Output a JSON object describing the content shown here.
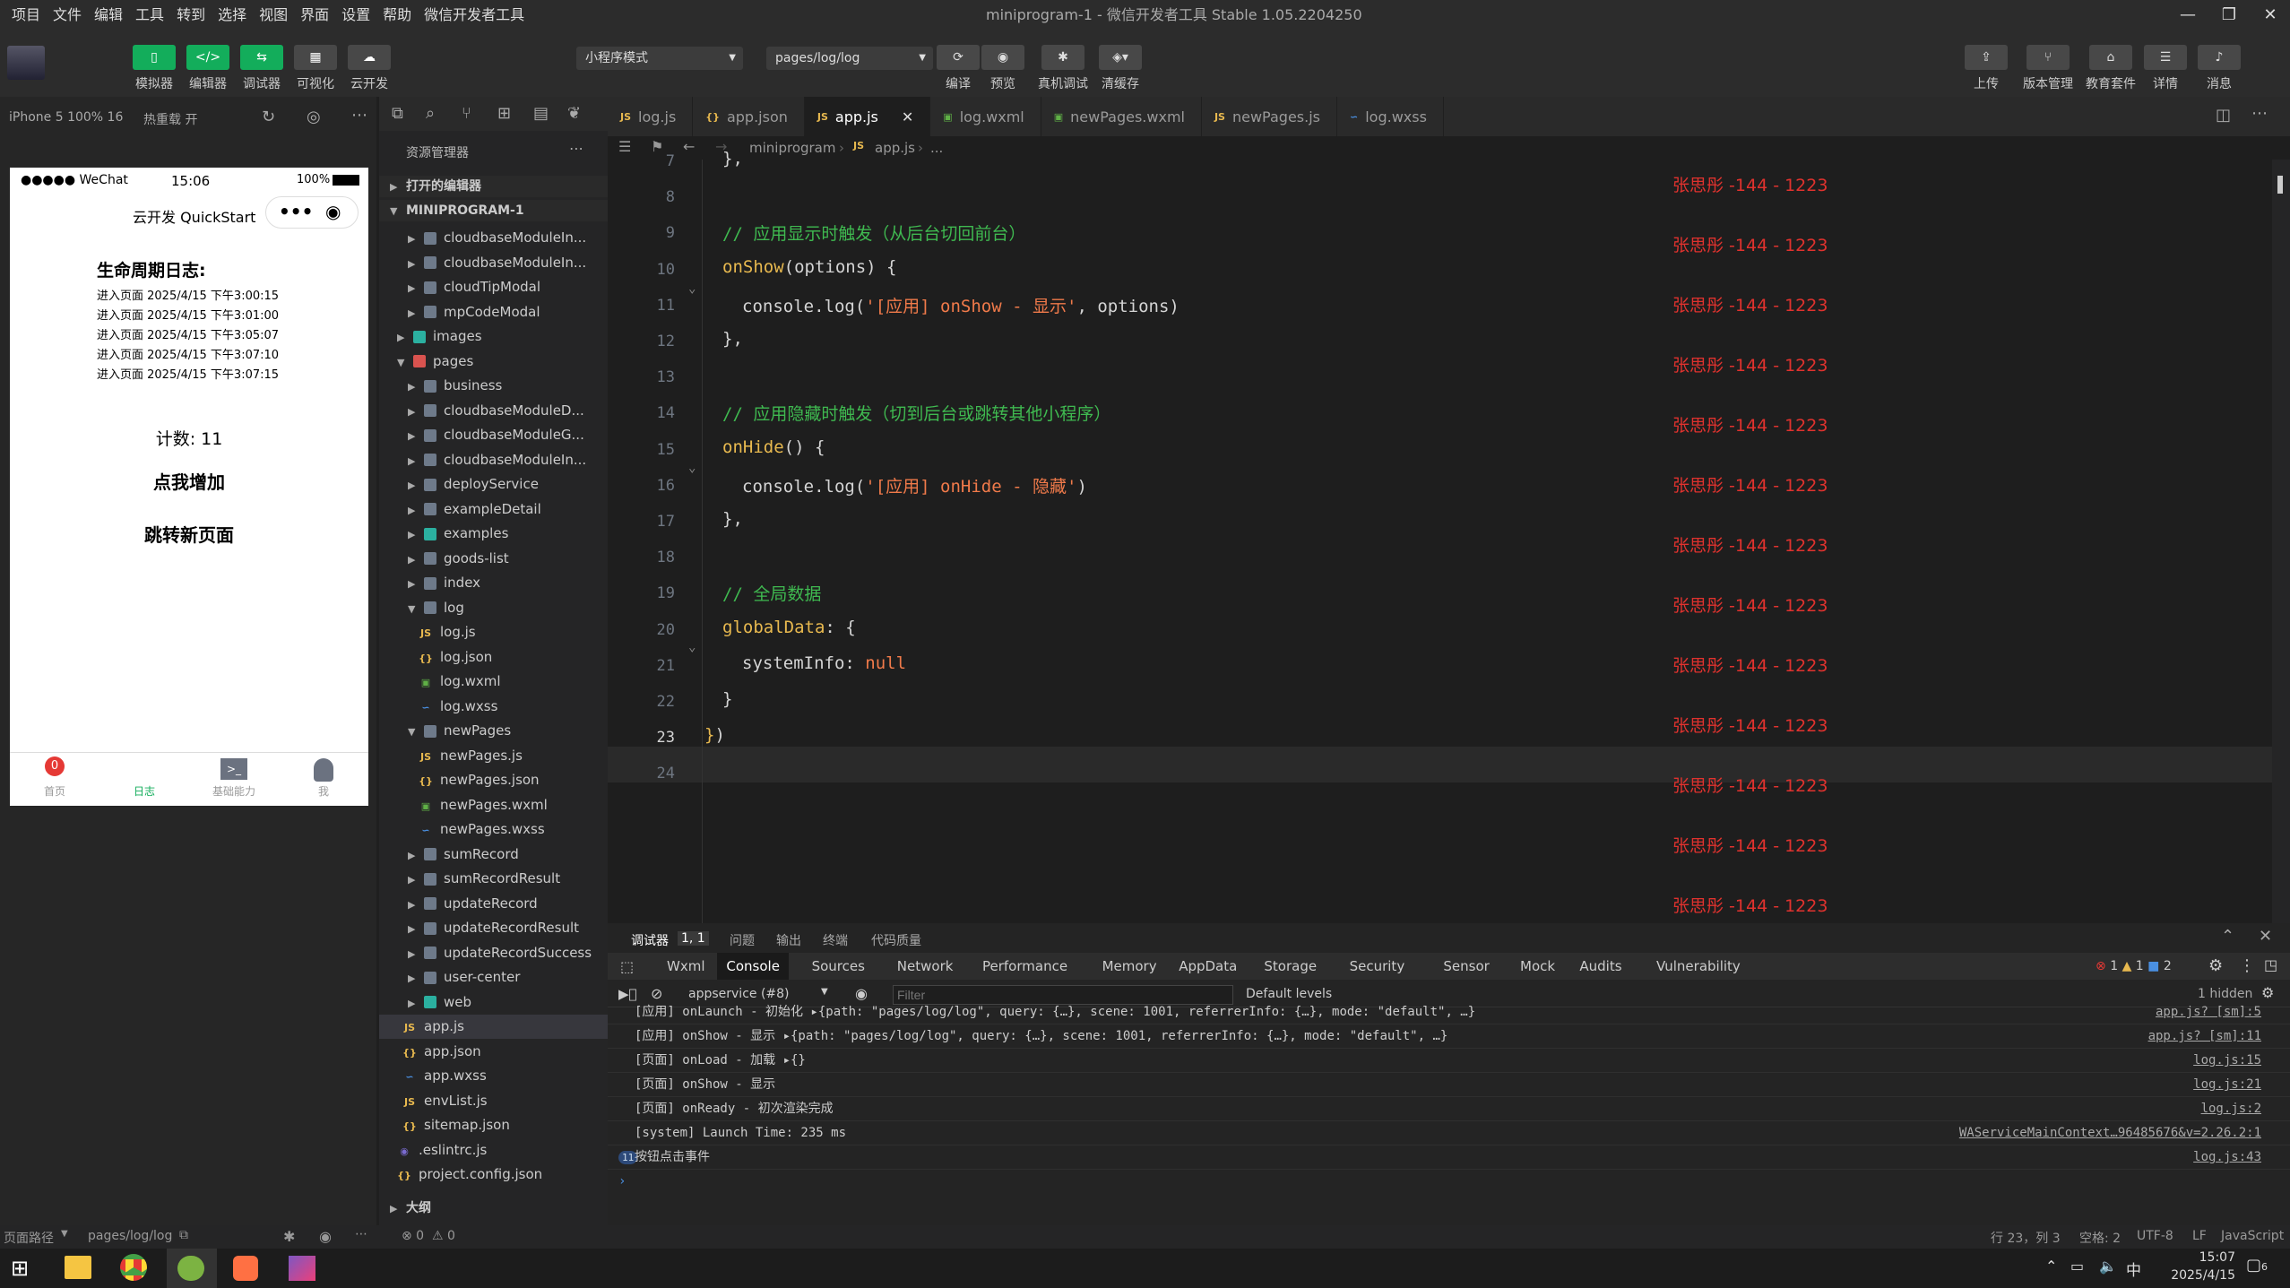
{
  "menu": [
    "项目",
    "文件",
    "编辑",
    "工具",
    "转到",
    "选择",
    "视图",
    "界面",
    "设置",
    "帮助",
    "微信开发者工具"
  ],
  "window_title": "miniprogram-1 - 微信开发者工具 Stable 1.05.2204250",
  "toolbar": {
    "left_buttons": [
      {
        "label": "模拟器",
        "icon": "phone-icon"
      },
      {
        "label": "编辑器",
        "icon": "code-icon"
      },
      {
        "label": "调试器",
        "icon": "debug-icon"
      },
      {
        "label": "可视化",
        "icon": "visual-icon"
      },
      {
        "label": "云开发",
        "icon": "cloud-icon"
      }
    ],
    "mode_select": "小程序模式",
    "page_select": "pages/log/log",
    "mid_buttons": [
      {
        "label": "编译"
      },
      {
        "label": "预览"
      },
      {
        "label": "真机调试"
      },
      {
        "label": "清缓存"
      }
    ],
    "right_buttons": [
      {
        "label": "上传"
      },
      {
        "label": "版本管理"
      },
      {
        "label": "教育套件"
      },
      {
        "label": "详情"
      },
      {
        "label": "消息"
      }
    ]
  },
  "sim": {
    "device": "iPhone 5 100% 16",
    "hot_reload": "热重载 开",
    "status_left": "●●●●● WeChat",
    "status_time": "15:06",
    "status_battery": "100%",
    "nav_title": "云开发 QuickStart",
    "heading": "生命周期日志:",
    "logs": [
      "进入页面 2025/4/15 下午3:00:15",
      "进入页面 2025/4/15 下午3:01:00",
      "进入页面 2025/4/15 下午3:05:07",
      "进入页面 2025/4/15 下午3:07:10",
      "进入页面 2025/4/15 下午3:07:15"
    ],
    "count": "计数: 11",
    "btn_add": "点我增加",
    "btn_jump": "跳转新页面",
    "tabbar": [
      {
        "label": "首页",
        "badge": "0"
      },
      {
        "label": "日志"
      },
      {
        "label": "基础能力"
      },
      {
        "label": "我"
      }
    ]
  },
  "explorer": {
    "title": "资源管理器",
    "open_editors": "打开的编辑器",
    "project": "MINIPROGRAM-1",
    "outline": "大纲",
    "rows": [
      {
        "t": "cloudbaseModuleIn...",
        "k": "folder",
        "d": 1,
        "c": true
      },
      {
        "t": "cloudbaseModuleIn...",
        "k": "folder",
        "d": 1,
        "c": true
      },
      {
        "t": "cloudTipModal",
        "k": "folder",
        "d": 1,
        "c": true
      },
      {
        "t": "mpCodeModal",
        "k": "folder",
        "d": 1,
        "c": true
      },
      {
        "t": "images",
        "k": "imgfolder",
        "d": 0,
        "c": true
      },
      {
        "t": "pages",
        "k": "pagesfolder",
        "d": 0,
        "o": true
      },
      {
        "t": "business",
        "k": "folder",
        "d": 1,
        "c": true
      },
      {
        "t": "cloudbaseModuleD...",
        "k": "folder",
        "d": 1,
        "c": true
      },
      {
        "t": "cloudbaseModuleG...",
        "k": "folder",
        "d": 1,
        "c": true
      },
      {
        "t": "cloudbaseModuleIn...",
        "k": "folder",
        "d": 1,
        "c": true
      },
      {
        "t": "deployService",
        "k": "folder",
        "d": 1,
        "c": true
      },
      {
        "t": "exampleDetail",
        "k": "folder",
        "d": 1,
        "c": true
      },
      {
        "t": "examples",
        "k": "tealfolder",
        "d": 1,
        "c": true
      },
      {
        "t": "goods-list",
        "k": "folder",
        "d": 1,
        "c": true
      },
      {
        "t": "index",
        "k": "folder",
        "d": 1,
        "c": true
      },
      {
        "t": "log",
        "k": "folder",
        "d": 1,
        "o": true
      },
      {
        "t": "log.js",
        "k": "js",
        "d": 2
      },
      {
        "t": "log.json",
        "k": "json",
        "d": 2
      },
      {
        "t": "log.wxml",
        "k": "wxml",
        "d": 2
      },
      {
        "t": "log.wxss",
        "k": "wxss",
        "d": 2
      },
      {
        "t": "newPages",
        "k": "folder",
        "d": 1,
        "o": true
      },
      {
        "t": "newPages.js",
        "k": "js",
        "d": 2
      },
      {
        "t": "newPages.json",
        "k": "json",
        "d": 2
      },
      {
        "t": "newPages.wxml",
        "k": "wxml",
        "d": 2
      },
      {
        "t": "newPages.wxss",
        "k": "wxss",
        "d": 2
      },
      {
        "t": "sumRecord",
        "k": "folder",
        "d": 1,
        "c": true
      },
      {
        "t": "sumRecordResult",
        "k": "folder",
        "d": 1,
        "c": true
      },
      {
        "t": "updateRecord",
        "k": "folder",
        "d": 1,
        "c": true
      },
      {
        "t": "updateRecordResult",
        "k": "folder",
        "d": 1,
        "c": true
      },
      {
        "t": "updateRecordSuccess",
        "k": "folder",
        "d": 1,
        "c": true
      },
      {
        "t": "user-center",
        "k": "folder",
        "d": 1,
        "c": true
      },
      {
        "t": "web",
        "k": "tealfolder",
        "d": 1,
        "c": true
      },
      {
        "t": "app.js",
        "k": "js",
        "d": 0.5,
        "active": true
      },
      {
        "t": "app.json",
        "k": "json",
        "d": 0.5
      },
      {
        "t": "app.wxss",
        "k": "wxss",
        "d": 0.5
      },
      {
        "t": "envList.js",
        "k": "js",
        "d": 0.5
      },
      {
        "t": "sitemap.json",
        "k": "json",
        "d": 0.5
      },
      {
        "t": ".eslintrc.js",
        "k": "eslint",
        "d": 0
      },
      {
        "t": "project.config.json",
        "k": "json",
        "d": 0
      }
    ]
  },
  "tabs": [
    {
      "label": "log.js",
      "k": "js"
    },
    {
      "label": "app.json",
      "k": "json"
    },
    {
      "label": "app.js",
      "k": "js",
      "active": true
    },
    {
      "label": "log.wxml",
      "k": "wxml"
    },
    {
      "label": "newPages.wxml",
      "k": "wxml"
    },
    {
      "label": "newPages.js",
      "k": "js"
    },
    {
      "label": "log.wxss",
      "k": "wxss"
    }
  ],
  "breadcrumb": [
    "miniprogram",
    "app.js",
    "..."
  ],
  "code": [
    {
      "n": "7",
      "html": "<span style='color:#d4d4d4'>},</span>"
    },
    {
      "n": "8",
      "html": ""
    },
    {
      "n": "9",
      "html": "<span style='color:#3fb950'>// 应用显示时触发（从后台切回前台）</span>"
    },
    {
      "n": "10",
      "html": "<span style='color:#e8b94f'>onShow</span><span style='color:#d4d4d4'>(options) {</span>"
    },
    {
      "n": "11",
      "html": "  <span style='color:#d4d4d4'>console.log(</span><span style='color:#f07a4a'>'[应用] onShow - 显示'</span><span style='color:#d4d4d4'>, options)</span>"
    },
    {
      "n": "12",
      "html": "<span style='color:#d4d4d4'>},</span>"
    },
    {
      "n": "13",
      "html": ""
    },
    {
      "n": "14",
      "html": "<span style='color:#3fb950'>// 应用隐藏时触发（切到后台或跳转其他小程序）</span>"
    },
    {
      "n": "15",
      "html": "<span style='color:#e8b94f'>onHide</span><span style='color:#d4d4d4'>() {</span>"
    },
    {
      "n": "16",
      "html": "  <span style='color:#d4d4d4'>console.log(</span><span style='color:#f07a4a'>'[应用] onHide - 隐藏'</span><span style='color:#d4d4d4'>)</span>"
    },
    {
      "n": "17",
      "html": "<span style='color:#d4d4d4'>},</span>"
    },
    {
      "n": "18",
      "html": ""
    },
    {
      "n": "19",
      "html": "<span style='color:#3fb950'>// 全局数据</span>"
    },
    {
      "n": "20",
      "html": "<span style='color:#e8b94f'>globalData</span><span style='color:#d4d4d4'>: {</span>"
    },
    {
      "n": "21",
      "html": "  <span style='color:#d4d4d4'>systemInfo: </span><span style='color:#f07a4a'>null</span>"
    },
    {
      "n": "22",
      "html": "<span style='color:#d4d4d4'>}</span>"
    },
    {
      "n": "23",
      "html": "<span style='color:#e8b94f'>}</span><span style='color:#d4d4d4'>)</span>"
    },
    {
      "n": "24",
      "html": ""
    }
  ],
  "watermark": "张思彤 -144 - 1223",
  "panel": {
    "tabs": [
      "调试器",
      "1, 1",
      "问题",
      "输出",
      "终端",
      "代码质量"
    ],
    "dev_tabs": [
      "Wxml",
      "Console",
      "Sources",
      "Network",
      "Performance",
      "Memory",
      "AppData",
      "Storage",
      "Security",
      "Sensor",
      "Mock",
      "Audits",
      "Vulnerability"
    ],
    "counts": {
      "errors": "1",
      "warnings": "1",
      "info": "2"
    },
    "context": "appservice (#8)",
    "filter_placeholder": "Filter",
    "levels": "Default levels",
    "hidden": "1 hidden",
    "console": [
      {
        "txt": "[应用] onLaunch - 初始化 ▸{path: \"pages/log/log\", query: {…}, scene: 1001, referrerInfo: {…}, mode: \"default\", …}",
        "src": "app.js? [sm]:5"
      },
      {
        "txt": "[应用] onShow - 显示 ▸{path: \"pages/log/log\", query: {…}, scene: 1001, referrerInfo: {…}, mode: \"default\", …}",
        "src": "app.js? [sm]:11"
      },
      {
        "txt": "[页面] onLoad - 加载 ▸{}",
        "src": "log.js:15"
      },
      {
        "txt": "[页面] onShow - 显示",
        "src": "log.js:21"
      },
      {
        "txt": "[页面] onReady - 初次渲染完成",
        "src": "log.js:2"
      },
      {
        "txt": "[system] Launch Time: 235 ms",
        "src": "WAServiceMainContext…96485676&v=2.26.2:1"
      },
      {
        "txt": "按钮点击事件",
        "src": "log.js:43",
        "badge": "11"
      }
    ]
  },
  "status": {
    "page_path_label": "页面路径",
    "page_path": "pages/log/log",
    "errors": "⊗ 0",
    "warns": "⚠ 0",
    "pos": "行 23，列 3",
    "spaces": "空格: 2",
    "enc": "UTF-8",
    "eol": "LF",
    "lang": "JavaScript"
  },
  "taskbar": {
    "time": "15:07",
    "date": "2025/4/15",
    "ime": "中",
    "notif": "6"
  }
}
